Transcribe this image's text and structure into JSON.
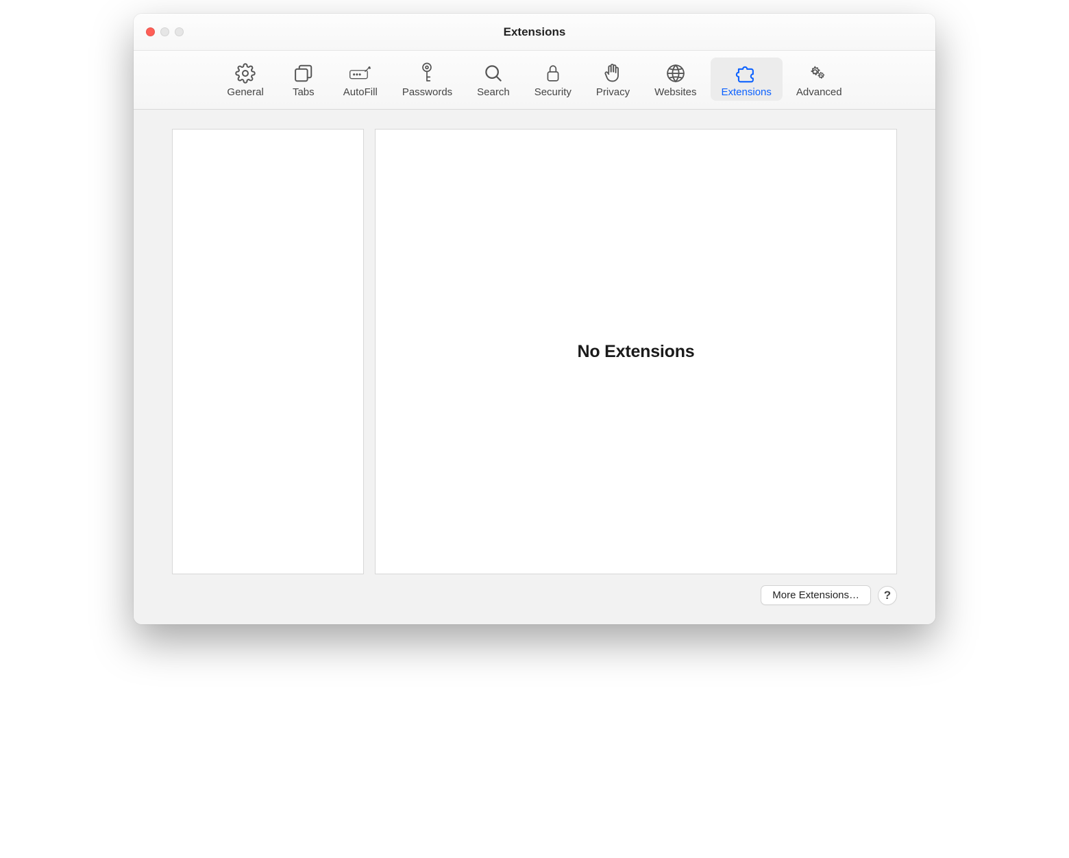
{
  "window": {
    "title": "Extensions"
  },
  "tabs": [
    {
      "id": "general",
      "label": "General",
      "icon": "gear-icon"
    },
    {
      "id": "tabs",
      "label": "Tabs",
      "icon": "tabs-icon"
    },
    {
      "id": "autofill",
      "label": "AutoFill",
      "icon": "autofill-icon"
    },
    {
      "id": "passwords",
      "label": "Passwords",
      "icon": "key-icon"
    },
    {
      "id": "search",
      "label": "Search",
      "icon": "search-icon"
    },
    {
      "id": "security",
      "label": "Security",
      "icon": "lock-icon"
    },
    {
      "id": "privacy",
      "label": "Privacy",
      "icon": "hand-icon"
    },
    {
      "id": "websites",
      "label": "Websites",
      "icon": "globe-icon"
    },
    {
      "id": "extensions",
      "label": "Extensions",
      "icon": "puzzle-icon",
      "selected": true
    },
    {
      "id": "advanced",
      "label": "Advanced",
      "icon": "gears-icon"
    }
  ],
  "main": {
    "empty_message": "No Extensions"
  },
  "buttons": {
    "more_extensions": "More Extensions…",
    "help": "?"
  }
}
